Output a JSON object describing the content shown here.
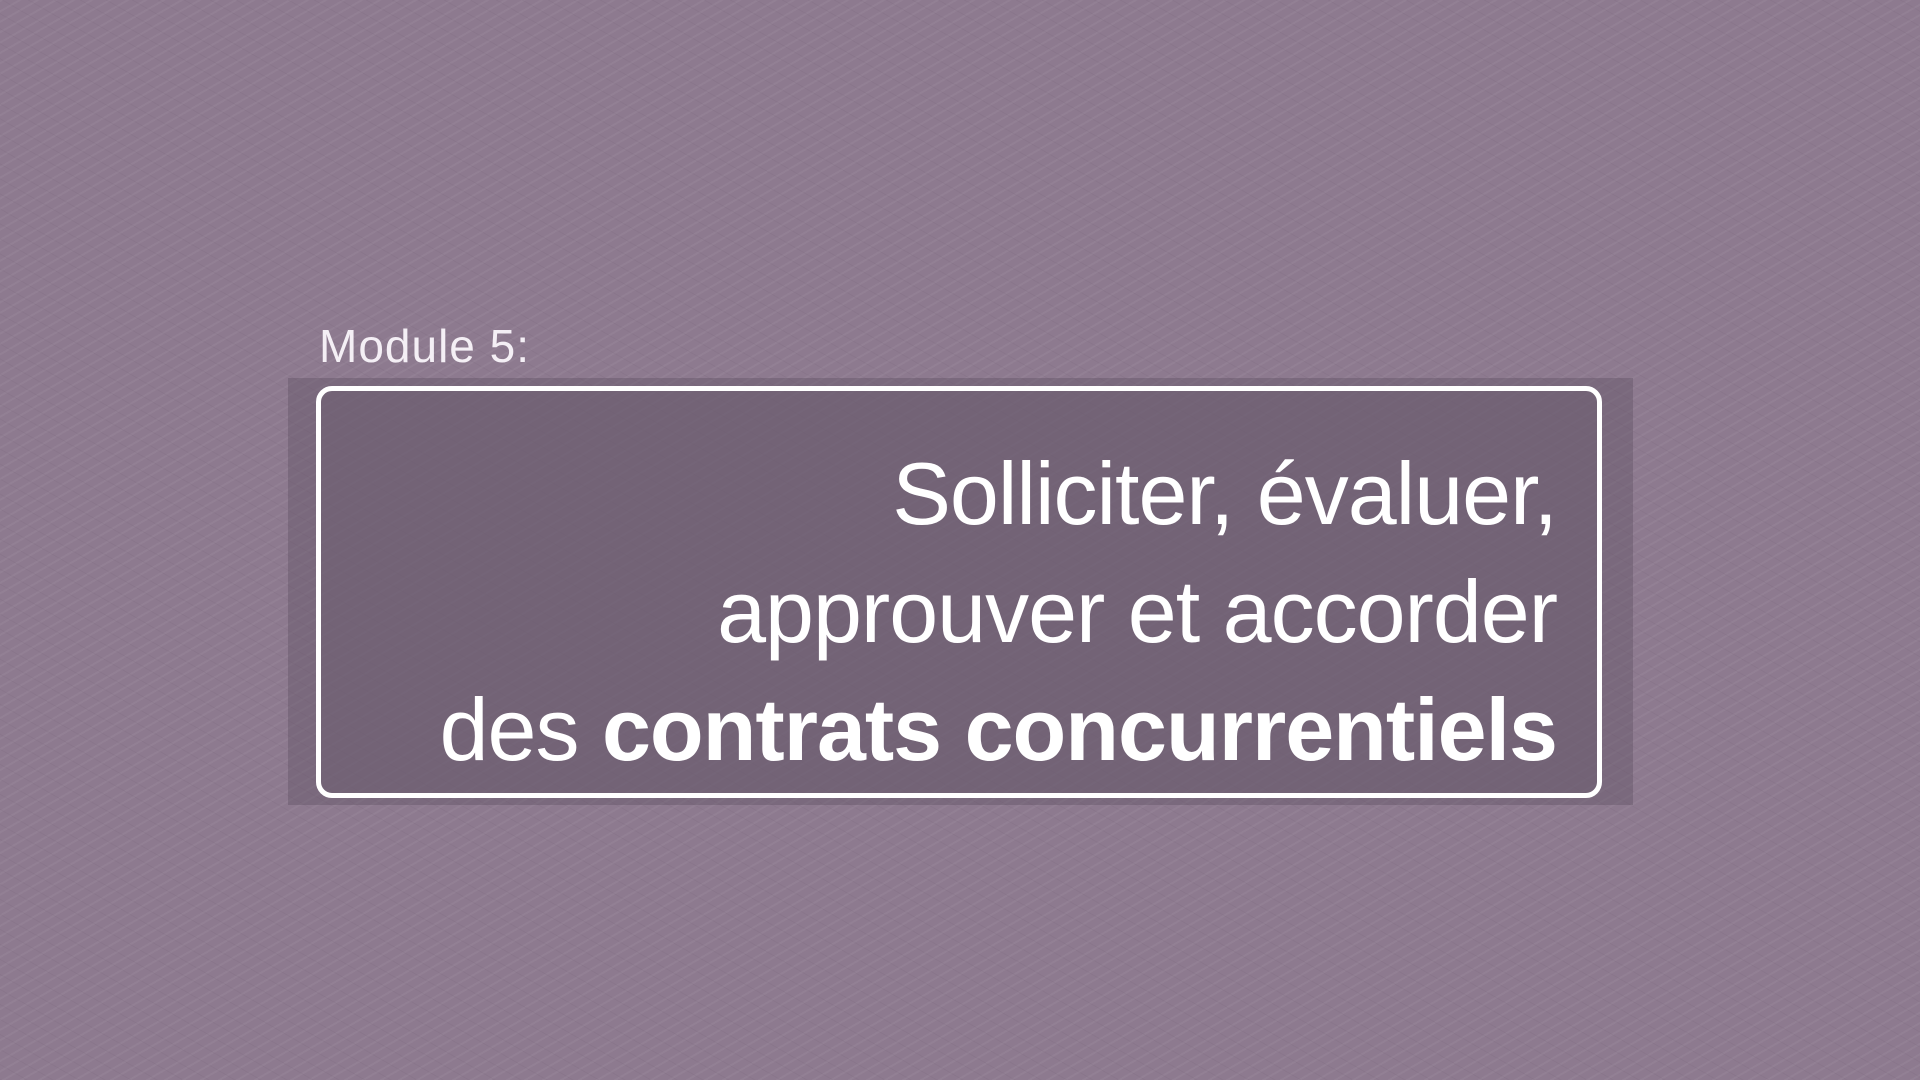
{
  "slide": {
    "module_label": "Module 5:",
    "title": {
      "line1": "Solliciter, évaluer,",
      "line2": "approuver et accorder",
      "line3_regular": "des",
      "line3_bold": "contrats concurrentiels"
    }
  },
  "colors": {
    "background": "#8d7a8f",
    "box_border": "#ffffff",
    "text": "#ffffff"
  }
}
